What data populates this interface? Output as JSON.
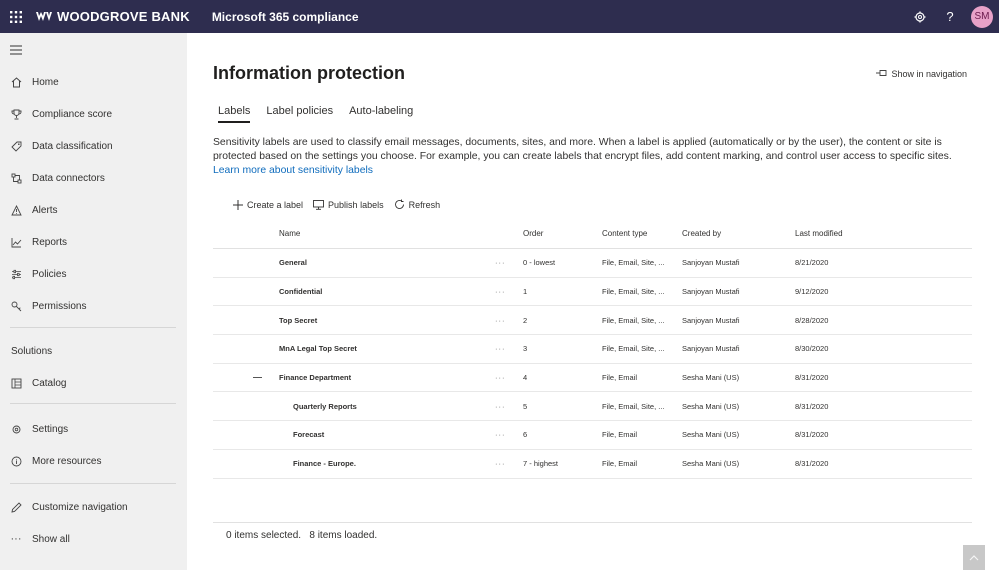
{
  "topbar": {
    "brand": "WOODGROVE BANK",
    "app_name": "Microsoft 365 compliance",
    "avatar_initials": "SM",
    "bg_color": "#2e2d4f"
  },
  "sidebar": {
    "items": [
      {
        "label": "Home",
        "icon": "home-icon"
      },
      {
        "label": "Compliance score",
        "icon": "trophy-icon"
      },
      {
        "label": "Data classification",
        "icon": "tag-icon"
      },
      {
        "label": "Data connectors",
        "icon": "connector-icon"
      },
      {
        "label": "Alerts",
        "icon": "alert-icon"
      },
      {
        "label": "Reports",
        "icon": "chart-icon"
      },
      {
        "label": "Policies",
        "icon": "sliders-icon"
      },
      {
        "label": "Permissions",
        "icon": "key-icon"
      }
    ],
    "solutions_heading": "Solutions",
    "solutions_items": [
      {
        "label": "Catalog",
        "icon": "catalog-icon"
      }
    ],
    "bottom_items": [
      {
        "label": "Settings",
        "icon": "gear-icon"
      },
      {
        "label": "More resources",
        "icon": "info-icon"
      }
    ],
    "footer_items": [
      {
        "label": "Customize navigation",
        "icon": "pencil-icon"
      },
      {
        "label": "Show all",
        "icon": "ellipsis-icon"
      }
    ]
  },
  "main": {
    "title": "Information protection",
    "show_in_nav": "Show in navigation",
    "tabs": [
      {
        "label": "Labels",
        "active": true
      },
      {
        "label": "Label policies",
        "active": false
      },
      {
        "label": "Auto-labeling",
        "active": false
      }
    ],
    "description": "Sensitivity labels are used to classify email messages, documents, sites, and more. When a label is applied (automatically or by the user), the content or site is protected based on the settings you choose. For example, you can create labels that encrypt files, add content marking, and control user access to specific sites.",
    "learn_more": "Learn more about sensitivity labels",
    "commands": {
      "create": "Create a label",
      "publish": "Publish labels",
      "refresh": "Refresh"
    },
    "columns": {
      "name": "Name",
      "order": "Order",
      "content_type": "Content type",
      "created_by": "Created by",
      "last_modified": "Last modified"
    },
    "rows": [
      {
        "name": "General",
        "more": "···",
        "order": "0 - lowest",
        "type": "File, Email, Site, ...",
        "by": "Sanjoyan Mustafi",
        "modified": "8/21/2020"
      },
      {
        "name": "Confidential",
        "more": "···",
        "order": "1",
        "type": "File, Email, Site, ...",
        "by": "Sanjoyan Mustafi",
        "modified": "9/12/2020"
      },
      {
        "name": "Top Secret",
        "more": "···",
        "order": "2",
        "type": "File, Email, Site, ...",
        "by": "Sanjoyan Mustafi",
        "modified": "8/28/2020"
      },
      {
        "name": "MnA Legal Top Secret",
        "more": "···",
        "order": "3",
        "type": "File, Email, Site, ...",
        "by": "Sanjoyan Mustafi",
        "modified": "8/30/2020"
      },
      {
        "name": "Finance Department",
        "more": "···",
        "order": "4",
        "type": "File, Email",
        "by": "Sesha Mani (US)",
        "modified": "8/31/2020"
      },
      {
        "name": "Quarterly Reports",
        "more": "···",
        "order": "5",
        "type": "File, Email, Site, ...",
        "by": "Sesha Mani (US)",
        "modified": "8/31/2020"
      },
      {
        "name": "Forecast",
        "more": "···",
        "order": "6",
        "type": "File, Email",
        "by": "Sesha Mani (US)",
        "modified": "8/31/2020"
      },
      {
        "name": "Finance - Europe.",
        "more": "···",
        "order": "7 - highest",
        "type": "File, Email",
        "by": "Sesha Mani (US)",
        "modified": "8/31/2020"
      }
    ],
    "footer_status": "0 items selected.   8 items loaded."
  }
}
